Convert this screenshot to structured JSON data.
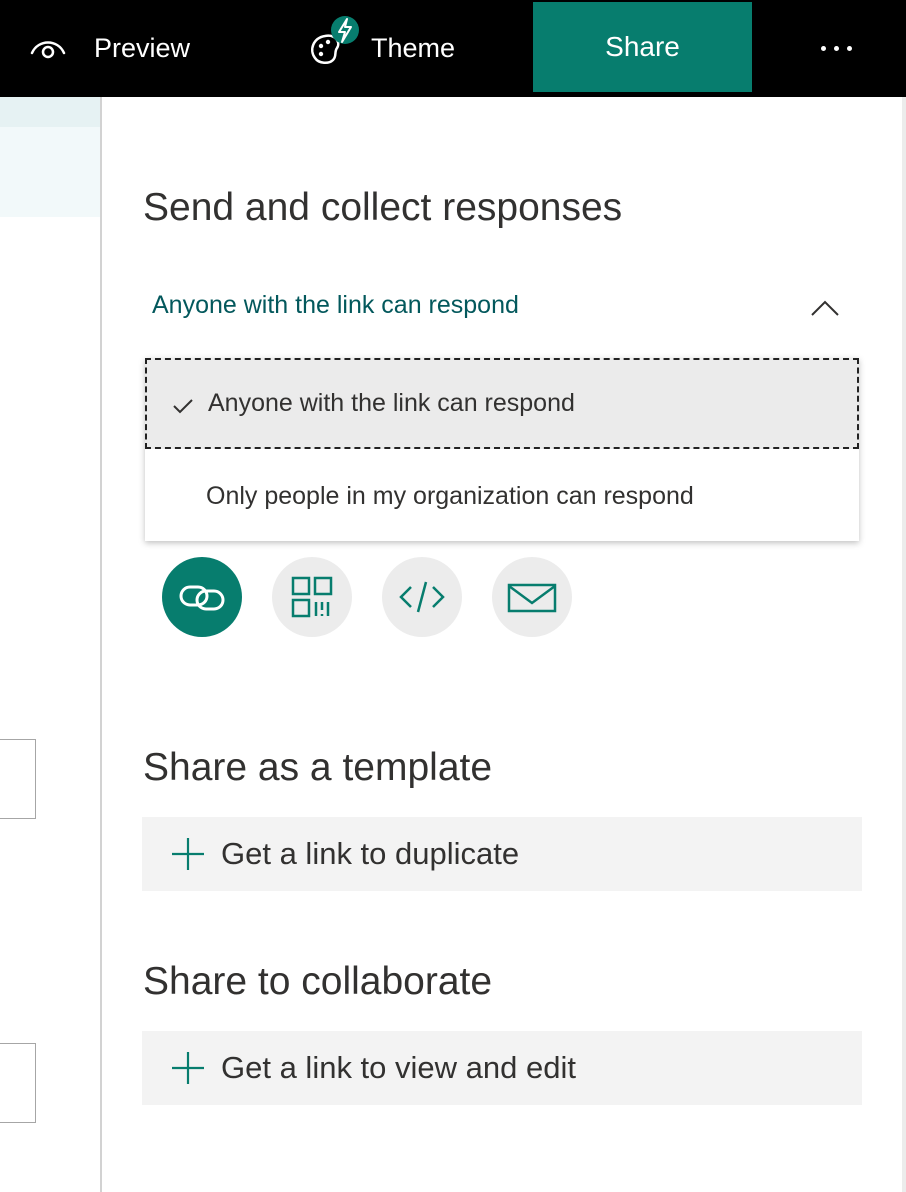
{
  "toolbar": {
    "preview_label": "Preview",
    "theme_label": "Theme",
    "share_label": "Share",
    "more_icon": "more-ellipsis-icon"
  },
  "panel": {
    "send_heading": "Send and collect responses",
    "audience": {
      "selected": "Anyone with the link can respond",
      "options": [
        "Anyone with the link can respond",
        "Only people in my organization can respond"
      ]
    },
    "share_methods": [
      "link-icon",
      "qr-code-icon",
      "embed-code-icon",
      "email-icon"
    ],
    "template_heading": "Share as a template",
    "template_action": "Get a link to duplicate",
    "collab_heading": "Share to collaborate",
    "collab_action": "Get a link to view and edit"
  },
  "colors": {
    "accent": "#077d6e",
    "link_text": "#03585c",
    "topbar": "#000000"
  }
}
